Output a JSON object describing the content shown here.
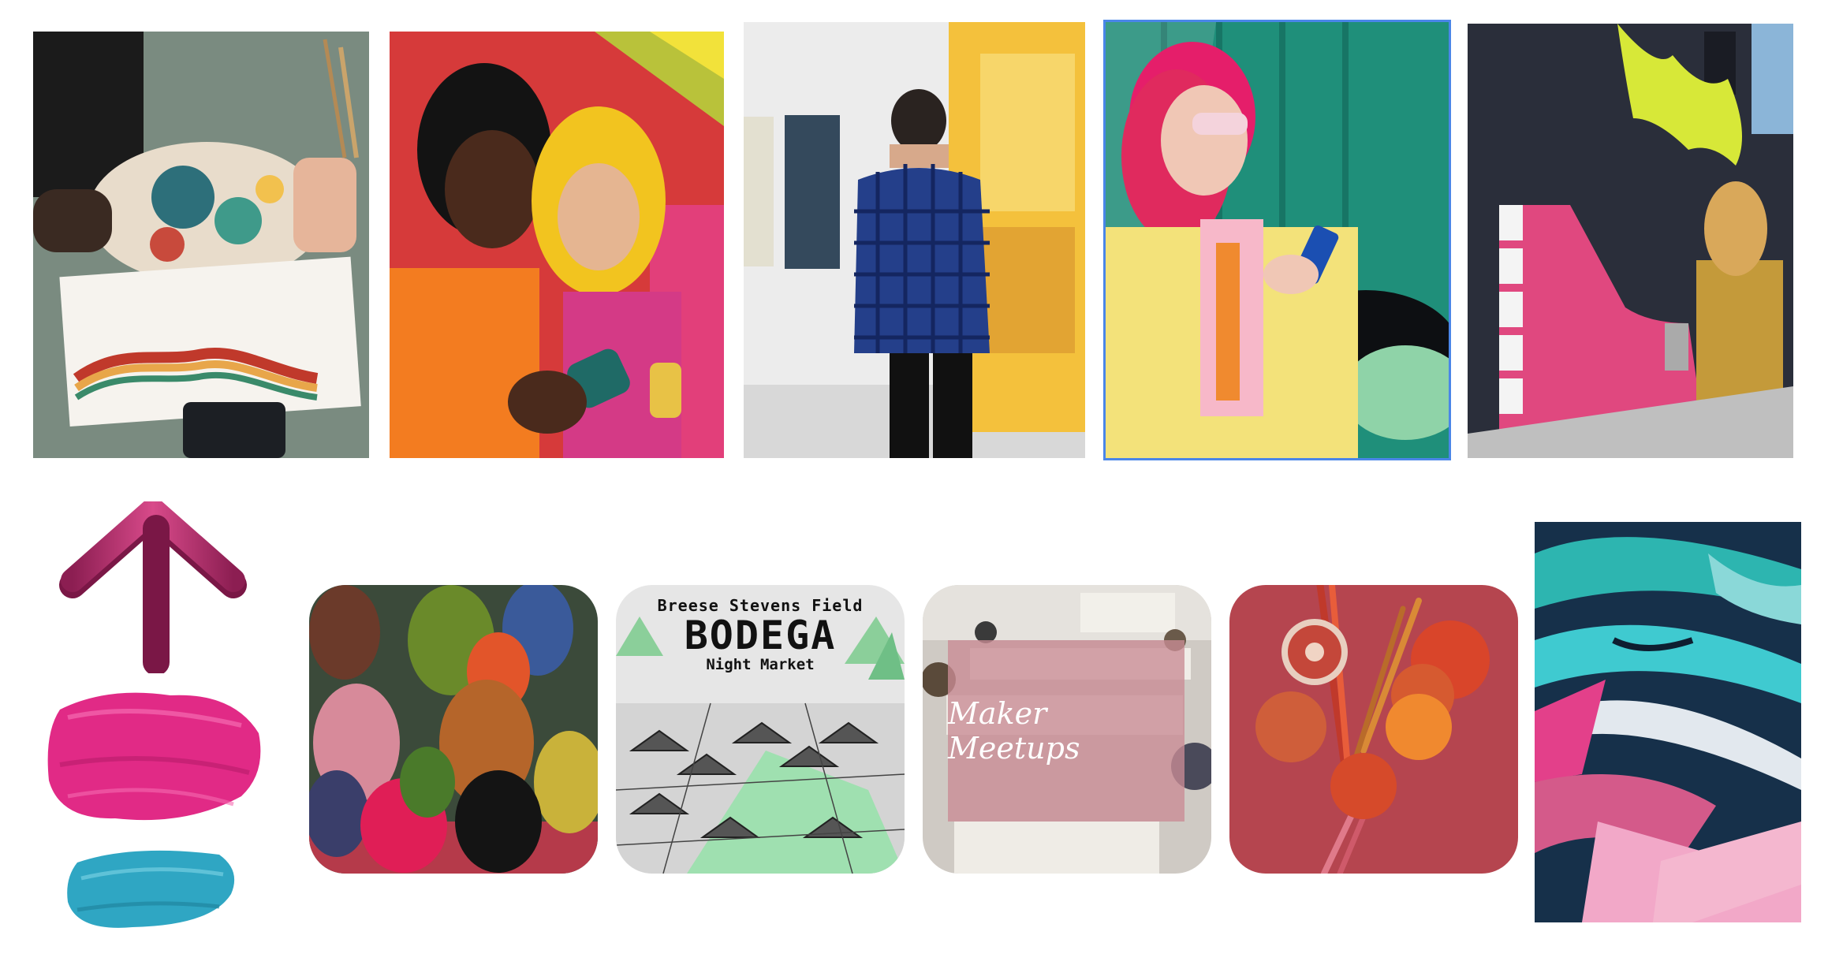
{
  "canvas": {
    "selected_tile": "photo-woman-pink-hat",
    "accent_colors": {
      "selection_outline": "#4a86e8",
      "arrow_magenta": "#c2326f",
      "brush_pink": "#e12a86",
      "brush_teal": "#2fa6c3",
      "maker_overlay": "#c98c95"
    }
  },
  "top_row": [
    {
      "name": "photo-painting-palette"
    },
    {
      "name": "photo-two-women-phone"
    },
    {
      "name": "photo-gallery-visitor"
    },
    {
      "name": "photo-woman-pink-hat"
    },
    {
      "name": "photo-street-mural"
    }
  ],
  "bottom_row": {
    "decorations": [
      "arrow-up-icon",
      "pink-brushstroke",
      "teal-brushstroke"
    ],
    "cards": [
      {
        "name": "card-ceramic-cats"
      },
      {
        "name": "card-bodega-night-market",
        "line1": "Breese Stevens Field",
        "line2": "BODEGA",
        "line3": "Night Market"
      },
      {
        "name": "card-maker-meetups",
        "overlay_text": "Maker Meetups"
      },
      {
        "name": "card-blood-oranges"
      },
      {
        "name": "card-abstract-mural"
      }
    ]
  }
}
